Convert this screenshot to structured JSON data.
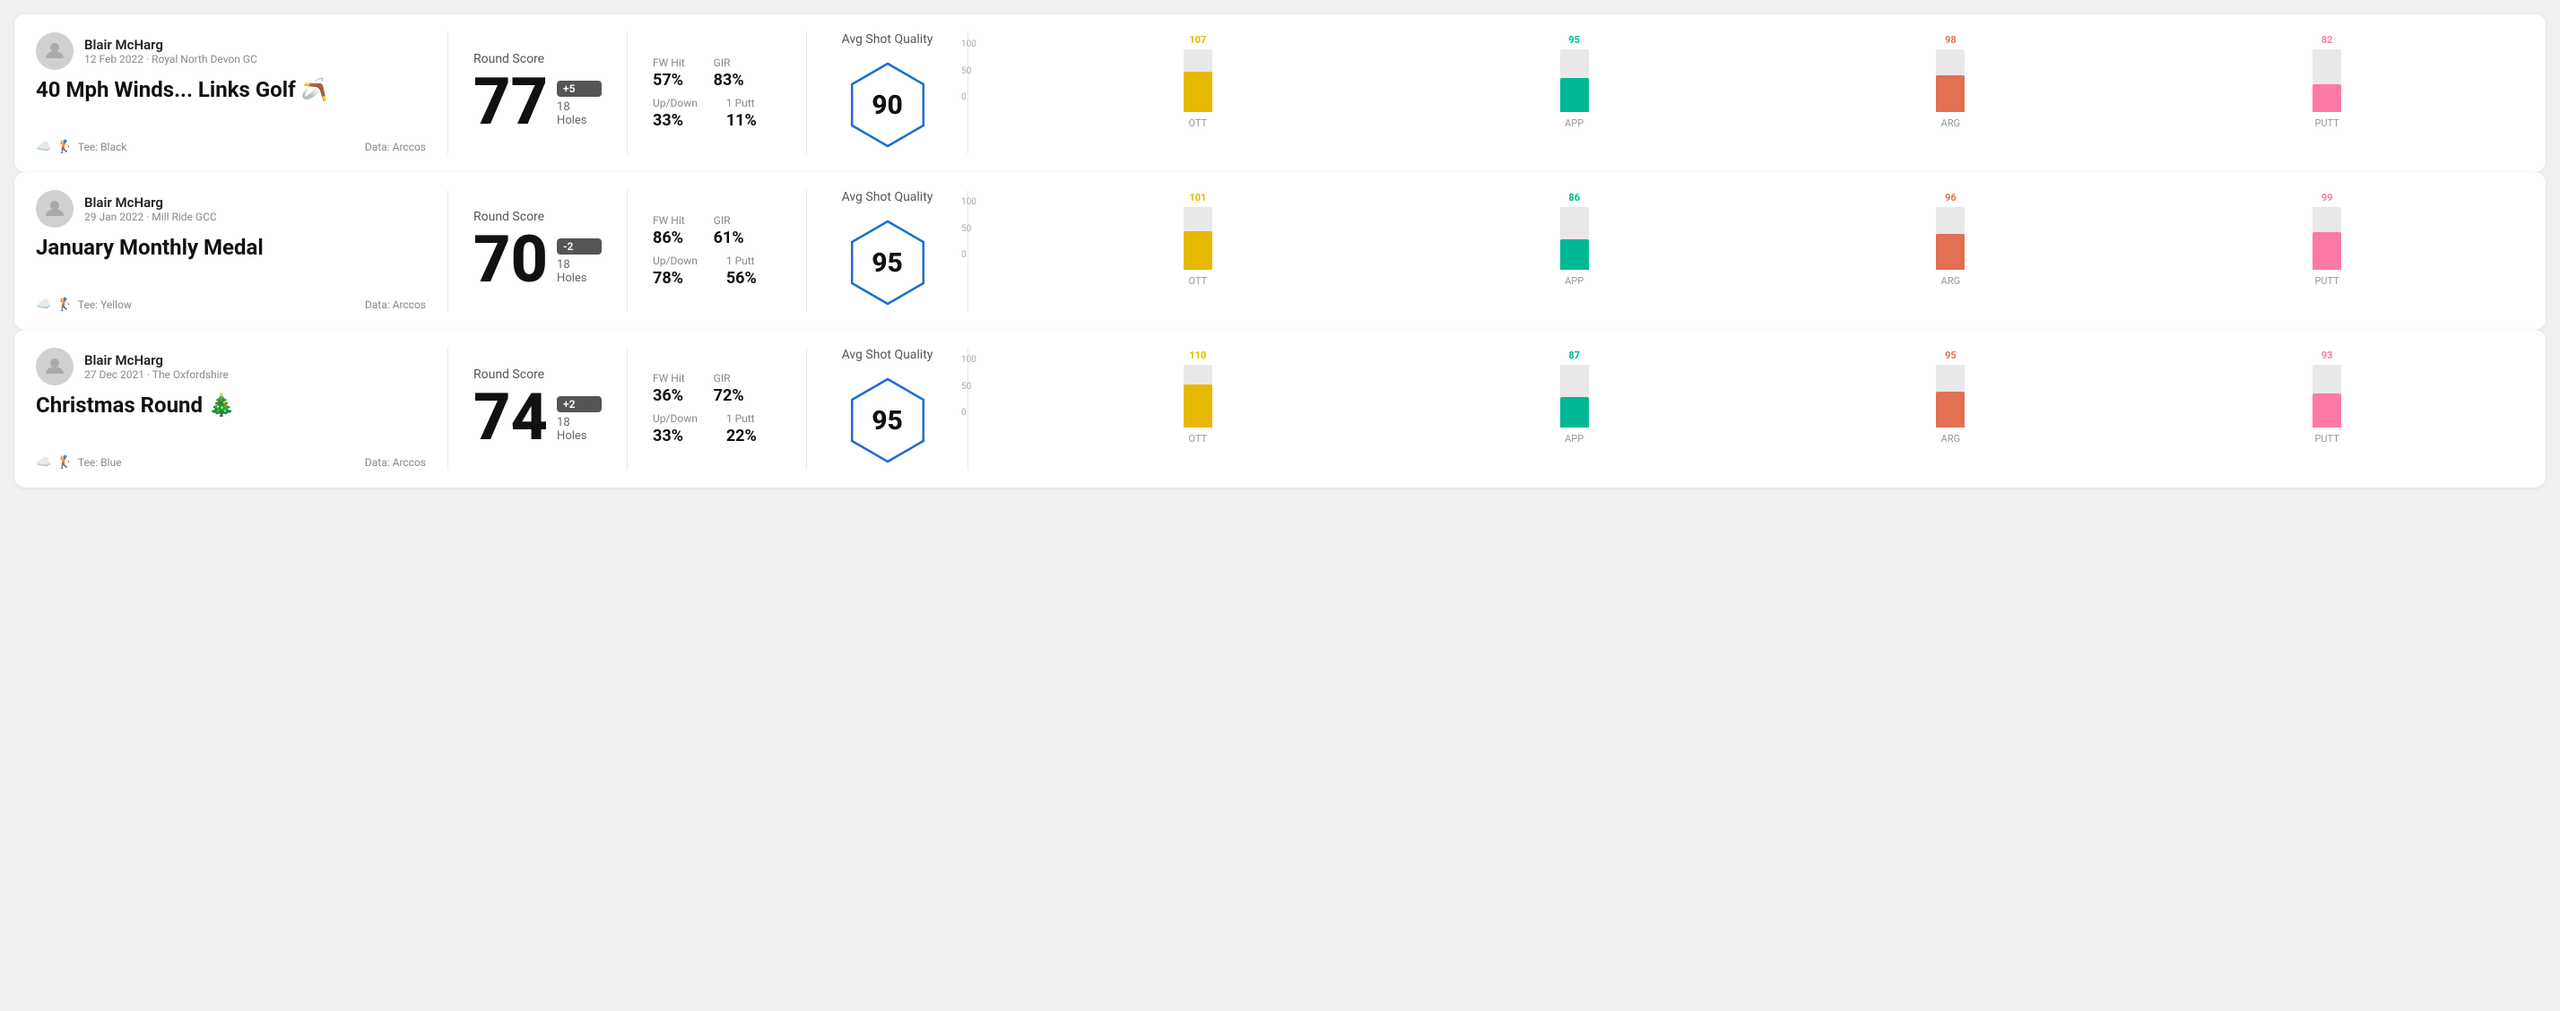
{
  "rounds": [
    {
      "id": "round1",
      "user": {
        "name": "Blair McHarg",
        "meta": "12 Feb 2022 · Royal North Devon GC"
      },
      "title": "40 Mph Winds... Links Golf 🪃",
      "tee": "Black",
      "data_source": "Data: Arccos",
      "score": {
        "label": "Round Score",
        "number": "77",
        "badge": "+5",
        "holes": "18 Holes"
      },
      "stats": [
        {
          "label": "FW Hit",
          "value": "57%"
        },
        {
          "label": "GIR",
          "value": "83%"
        },
        {
          "label": "Up/Down",
          "value": "33%"
        },
        {
          "label": "1 Putt",
          "value": "11%"
        }
      ],
      "quality": {
        "label": "Avg Shot Quality",
        "score": "90"
      },
      "chart": {
        "bars": [
          {
            "label": "OTT",
            "value": 107,
            "color": "#e6b800",
            "height_pct": 65
          },
          {
            "label": "APP",
            "value": 95,
            "color": "#00b894",
            "height_pct": 55
          },
          {
            "label": "ARG",
            "value": 98,
            "color": "#e17055",
            "height_pct": 58
          },
          {
            "label": "PUTT",
            "value": 82,
            "color": "#fd79a8",
            "height_pct": 45
          }
        ],
        "y_labels": [
          "100",
          "50",
          "0"
        ]
      }
    },
    {
      "id": "round2",
      "user": {
        "name": "Blair McHarg",
        "meta": "29 Jan 2022 · Mill Ride GCC"
      },
      "title": "January Monthly Medal",
      "tee": "Yellow",
      "data_source": "Data: Arccos",
      "score": {
        "label": "Round Score",
        "number": "70",
        "badge": "-2",
        "holes": "18 Holes"
      },
      "stats": [
        {
          "label": "FW Hit",
          "value": "86%"
        },
        {
          "label": "GIR",
          "value": "61%"
        },
        {
          "label": "Up/Down",
          "value": "78%"
        },
        {
          "label": "1 Putt",
          "value": "56%"
        }
      ],
      "quality": {
        "label": "Avg Shot Quality",
        "score": "95"
      },
      "chart": {
        "bars": [
          {
            "label": "OTT",
            "value": 101,
            "color": "#e6b800",
            "height_pct": 62
          },
          {
            "label": "APP",
            "value": 86,
            "color": "#00b894",
            "height_pct": 48
          },
          {
            "label": "ARG",
            "value": 96,
            "color": "#e17055",
            "height_pct": 57
          },
          {
            "label": "PUTT",
            "value": 99,
            "color": "#fd79a8",
            "height_pct": 60
          }
        ],
        "y_labels": [
          "100",
          "50",
          "0"
        ]
      }
    },
    {
      "id": "round3",
      "user": {
        "name": "Blair McHarg",
        "meta": "27 Dec 2021 · The Oxfordshire"
      },
      "title": "Christmas Round 🎄",
      "tee": "Blue",
      "data_source": "Data: Arccos",
      "score": {
        "label": "Round Score",
        "number": "74",
        "badge": "+2",
        "holes": "18 Holes"
      },
      "stats": [
        {
          "label": "FW Hit",
          "value": "36%"
        },
        {
          "label": "GIR",
          "value": "72%"
        },
        {
          "label": "Up/Down",
          "value": "33%"
        },
        {
          "label": "1 Putt",
          "value": "22%"
        }
      ],
      "quality": {
        "label": "Avg Shot Quality",
        "score": "95"
      },
      "chart": {
        "bars": [
          {
            "label": "OTT",
            "value": 110,
            "color": "#e6b800",
            "height_pct": 68
          },
          {
            "label": "APP",
            "value": 87,
            "color": "#00b894",
            "height_pct": 49
          },
          {
            "label": "ARG",
            "value": 95,
            "color": "#e17055",
            "height_pct": 57
          },
          {
            "label": "PUTT",
            "value": 93,
            "color": "#fd79a8",
            "height_pct": 55
          }
        ],
        "y_labels": [
          "100",
          "50",
          "0"
        ]
      }
    }
  ]
}
